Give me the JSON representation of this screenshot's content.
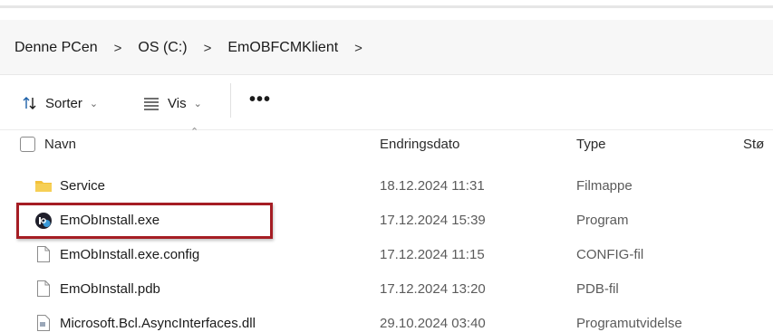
{
  "breadcrumb": {
    "items": [
      "Denne PCen",
      "OS (C:)",
      "EmOBFCMKlient"
    ],
    "separator": ">"
  },
  "toolbar": {
    "sort_label": "Sorter",
    "view_label": "Vis",
    "more_label": "•••"
  },
  "columns": {
    "name": "Navn",
    "modified": "Endringsdato",
    "type": "Type",
    "size": "Stø"
  },
  "files": [
    {
      "name": "Service",
      "modified": "18.12.2024 11:31",
      "type": "Filmappe",
      "icon": "folder-icon"
    },
    {
      "name": "EmObInstall.exe",
      "modified": "17.12.2024 15:39",
      "type": "Program",
      "icon": "app-icon"
    },
    {
      "name": "EmObInstall.exe.config",
      "modified": "17.12.2024 11:15",
      "type": "CONFIG-fil",
      "icon": "file-icon"
    },
    {
      "name": "EmObInstall.pdb",
      "modified": "17.12.2024 13:20",
      "type": "PDB-fil",
      "icon": "file-icon"
    },
    {
      "name": "Microsoft.Bcl.AsyncInterfaces.dll",
      "modified": "29.10.2024 03:40",
      "type": "Programutvidelse",
      "icon": "dll-icon"
    }
  ],
  "colors": {
    "highlight": "#a51d24",
    "folder": "#f3c13a"
  }
}
